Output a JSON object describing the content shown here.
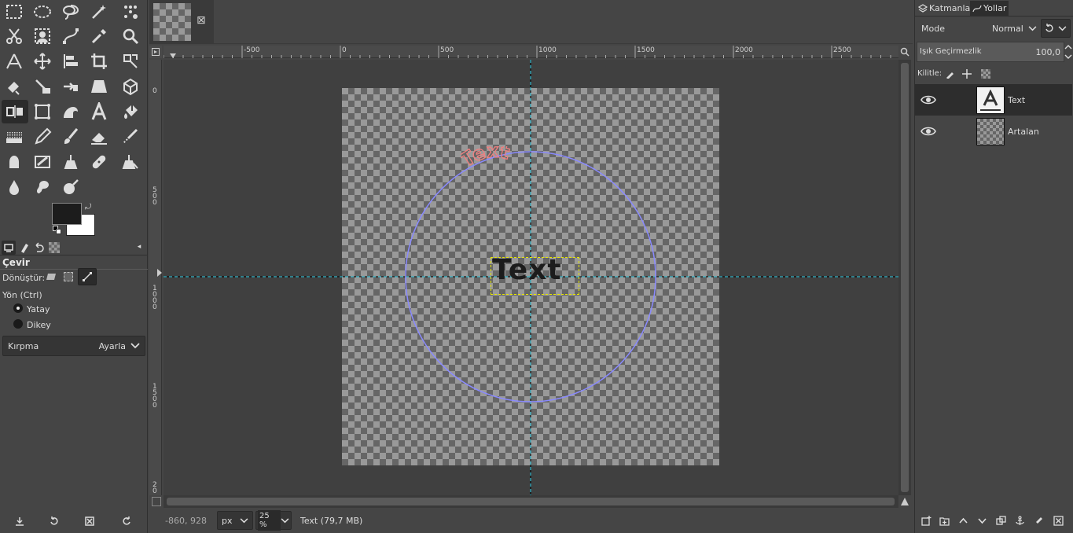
{
  "image_tab": {
    "close_glyph": "⊠"
  },
  "tool_options": {
    "title": "Çevir",
    "transform_label": "Dönüştür:",
    "direction_label": "Yön  (Ctrl)",
    "horizontal_label": "Yatay",
    "vertical_label": "Dikey",
    "clipping_label": "Kırpma",
    "clipping_value": "Ayarla"
  },
  "ruler": {
    "h_ticks": [
      "-500",
      "0",
      "500",
      "1000",
      "1500",
      "2000",
      "2500"
    ],
    "v_ticks": [
      "0",
      "5\n0\n0",
      "1\n0\n0\n0",
      "1\n5\n0\n0",
      "2\n0"
    ]
  },
  "canvas": {
    "text_layer_content": "Text",
    "curved_text": "Text"
  },
  "statusbar": {
    "coords": "-860, 928",
    "unit": "px",
    "zoom": "25 %",
    "info": "Text (79,7 MB)"
  },
  "layers_panel": {
    "tabs": [
      "Katmanlar",
      "Yollar"
    ],
    "mode_label": "Mode",
    "mode_value": "Normal",
    "opacity_label": "Işık Geçirmezlik",
    "opacity_value": "100,0",
    "lock_label": "Kilitle:",
    "layers": [
      {
        "name": "Text",
        "visible": true,
        "type": "text"
      },
      {
        "name": "Artalan",
        "visible": true,
        "type": "raster"
      }
    ]
  },
  "colors": {
    "foreground": "#1c1c1c",
    "background": "#ffffff",
    "guide": "#00bcd4",
    "path": "#8a8aff",
    "curved_text": "#f08080"
  }
}
